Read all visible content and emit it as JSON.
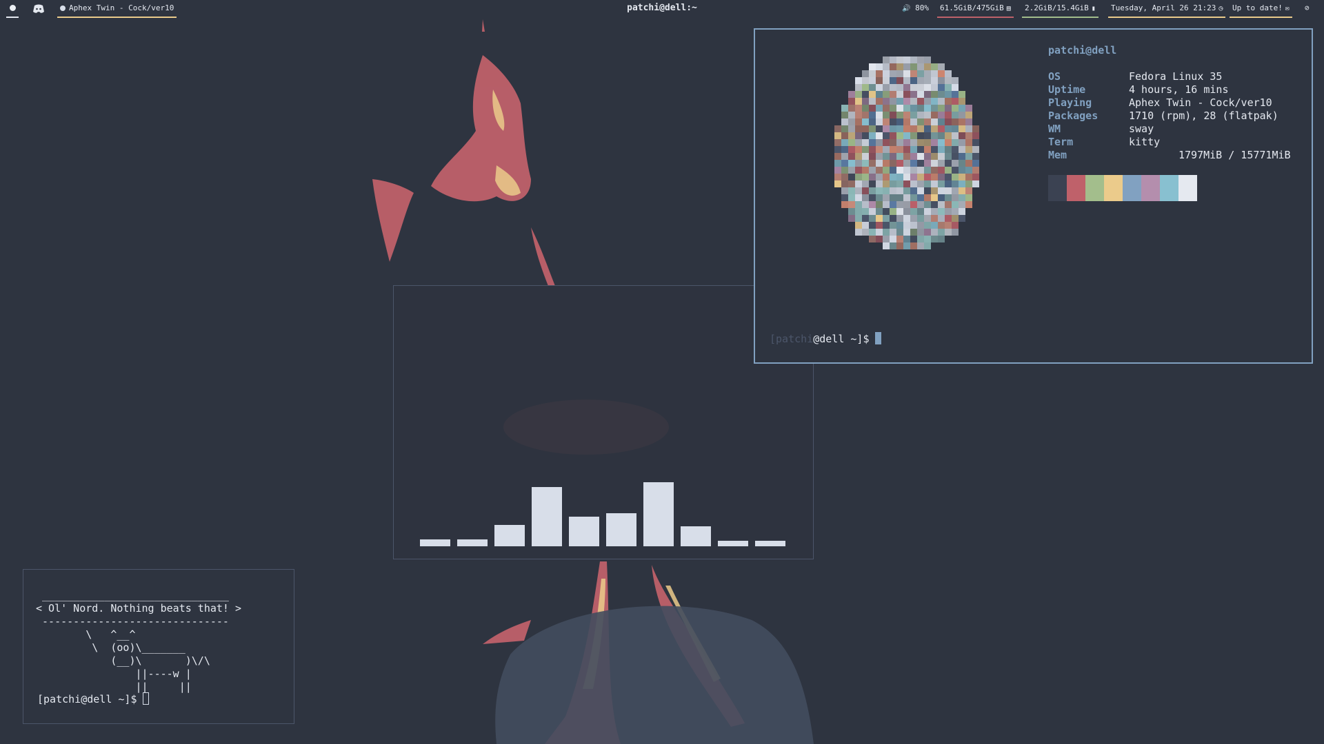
{
  "bar": {
    "media_title": "Aphex Twin - Cock/ver10",
    "window_title": "patchi@dell:~",
    "volume": "80%",
    "disk": "61.5GiB/475GiB",
    "memory": "2.2GiB/15.4GiB",
    "datetime": "Tuesday, April 26 21:23",
    "updates": "Up to date!",
    "icons": [
      "workspace-dot-icon",
      "discord-icon",
      "speaker-icon",
      "disk-icon",
      "memory-icon",
      "clock-icon",
      "mail-icon",
      "eye-slash-icon"
    ]
  },
  "neofetch": {
    "header": "patchi@dell",
    "rows": [
      {
        "key": "OS",
        "value": "Fedora Linux 35"
      },
      {
        "key": "Uptime",
        "value": "4 hours, 16 mins"
      },
      {
        "key": "Playing",
        "value": "Aphex Twin - Cock/ver10"
      },
      {
        "key": "Packages",
        "value": "1710 (rpm), 28 (flatpak)"
      },
      {
        "key": "WM",
        "value": "sway"
      },
      {
        "key": "Term",
        "value": "kitty"
      },
      {
        "key": "Mem",
        "value": "1797MiB / 15771MiB"
      }
    ],
    "palette": [
      "#3b4252",
      "#bf616a",
      "#a3be8c",
      "#ebcb8b",
      "#81a1c1",
      "#b48ead",
      "#88c0d0",
      "#e5e9f0"
    ],
    "prompt_dim": "[patchi",
    "prompt_rest": "@dell ~]$"
  },
  "cava": {
    "levels": [
      0.1,
      0.1,
      0.33,
      0.9,
      0.45,
      0.5,
      0.98,
      0.3,
      0.08,
      0.08
    ]
  },
  "cowsay": {
    "text": " ______________________________\n< Ol' Nord. Nothing beats that! >\n ------------------------------\n        \\   ^__^\n         \\  (oo)\\_______\n            (__)\\       )\\/\\\n                ||----w |\n                ||     ||",
    "prompt": "[patchi@dell ~]$"
  },
  "colors": {
    "background": "#2e3440",
    "accent": "#81a1c1",
    "foreground": "#e5e9f0"
  }
}
